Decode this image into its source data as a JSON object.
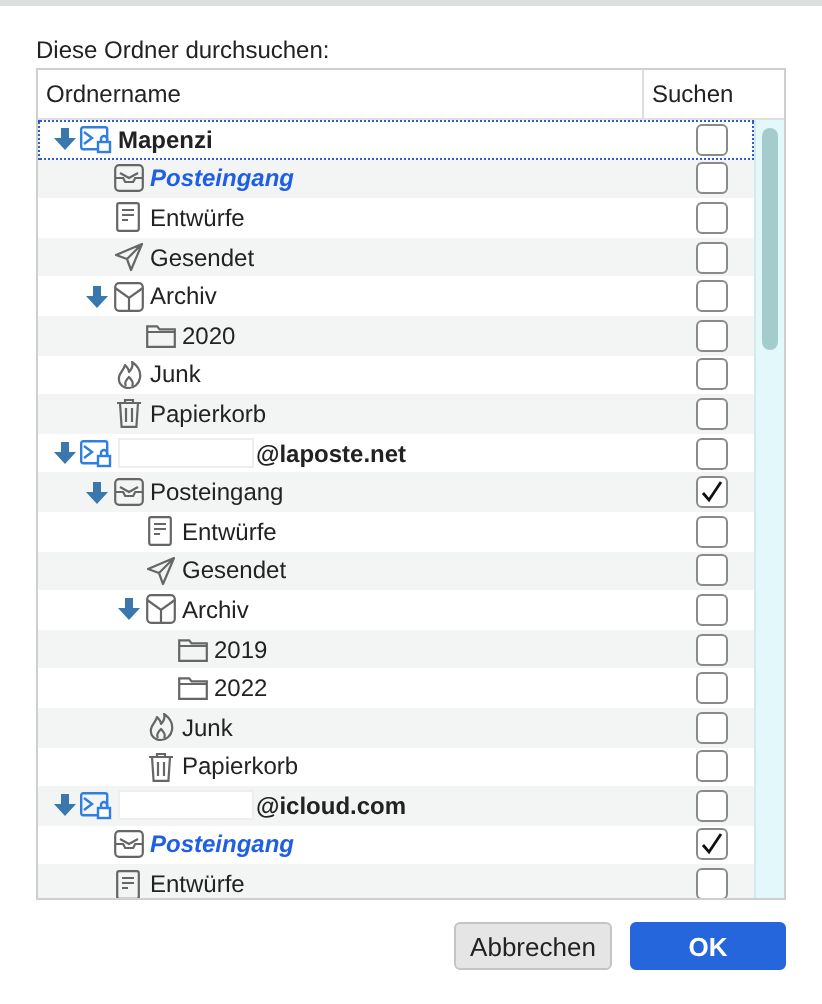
{
  "prompt": "Diese Ordner durchsuchen:",
  "columns": [
    "Ordnername",
    "Suchen"
  ],
  "folders": [
    {
      "name": "Mapenzi",
      "kind": "account",
      "redacted": false,
      "focused": true,
      "expanded": true,
      "highlighted": false,
      "checked": false,
      "children": [
        {
          "name": "Posteingang",
          "kind": "inbox",
          "highlighted": true,
          "checked": false,
          "expanded": false
        },
        {
          "name": "Entwürfe",
          "kind": "drafts",
          "highlighted": false,
          "checked": false,
          "expanded": false
        },
        {
          "name": "Gesendet",
          "kind": "sent",
          "highlighted": false,
          "checked": false,
          "expanded": false
        },
        {
          "name": "Archiv",
          "kind": "archive",
          "highlighted": false,
          "checked": false,
          "expanded": true,
          "children": [
            {
              "name": "2020",
              "kind": "folder",
              "highlighted": false,
              "checked": false,
              "expanded": false
            }
          ]
        },
        {
          "name": "Junk",
          "kind": "junk",
          "highlighted": false,
          "checked": false,
          "expanded": false
        },
        {
          "name": "Papierkorb",
          "kind": "trash",
          "highlighted": false,
          "checked": false,
          "expanded": false
        }
      ]
    },
    {
      "name": "@laposte.net",
      "kind": "account",
      "redacted": true,
      "focused": false,
      "expanded": true,
      "highlighted": false,
      "checked": false,
      "children": [
        {
          "name": "Posteingang",
          "kind": "inbox",
          "highlighted": false,
          "checked": true,
          "expanded": true,
          "children": [
            {
              "name": "Entwürfe",
              "kind": "drafts",
              "highlighted": false,
              "checked": false,
              "expanded": false
            },
            {
              "name": "Gesendet",
              "kind": "sent",
              "highlighted": false,
              "checked": false,
              "expanded": false
            },
            {
              "name": "Archiv",
              "kind": "archive",
              "highlighted": false,
              "checked": false,
              "expanded": true,
              "children": [
                {
                  "name": "2019",
                  "kind": "folder",
                  "highlighted": false,
                  "checked": false,
                  "expanded": false
                },
                {
                  "name": "2022",
                  "kind": "folder",
                  "highlighted": false,
                  "checked": false,
                  "expanded": false
                }
              ]
            },
            {
              "name": "Junk",
              "kind": "junk",
              "highlighted": false,
              "checked": false,
              "expanded": false
            },
            {
              "name": "Papierkorb",
              "kind": "trash",
              "highlighted": false,
              "checked": false,
              "expanded": false
            }
          ]
        }
      ]
    },
    {
      "name": "@icloud.com",
      "kind": "account",
      "redacted": true,
      "focused": false,
      "expanded": true,
      "highlighted": false,
      "checked": false,
      "children": [
        {
          "name": "Posteingang",
          "kind": "inbox",
          "highlighted": true,
          "checked": true,
          "expanded": false
        },
        {
          "name": "Entwürfe",
          "kind": "drafts",
          "highlighted": false,
          "checked": false,
          "expanded": false
        }
      ]
    }
  ],
  "buttons": [
    {
      "label": "Abbrechen",
      "kind": "secondary"
    },
    {
      "label": "OK",
      "kind": "primary"
    }
  ]
}
